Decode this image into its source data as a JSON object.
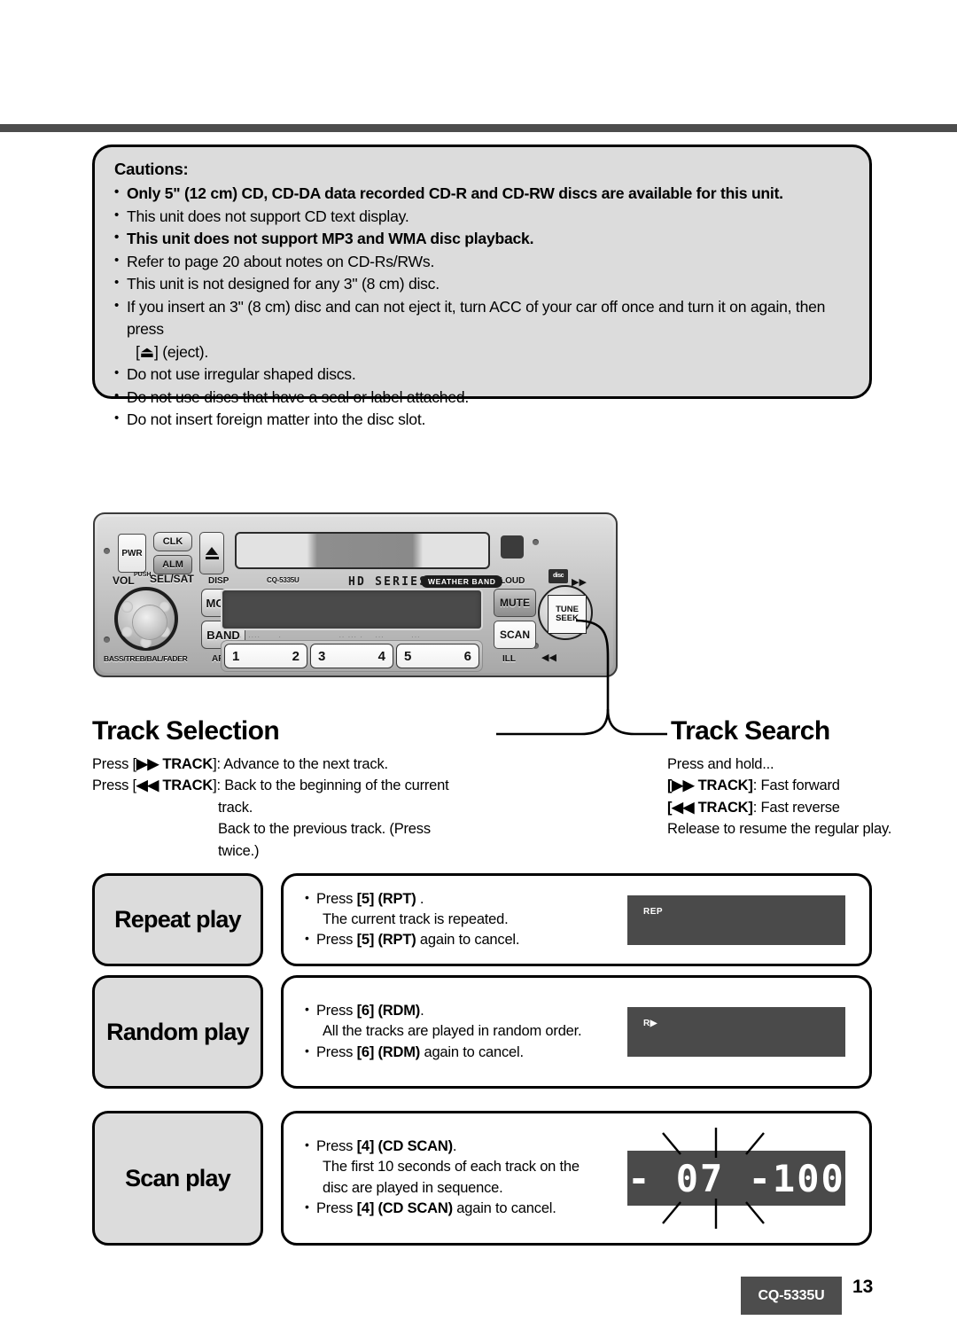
{
  "cautions": {
    "title": "Cautions:",
    "items": [
      {
        "text": "Only 5\" (12 cm) CD, CD-DA data recorded CD-R and CD-RW discs are available for this unit.",
        "bold": true
      },
      {
        "text": "This unit does not support CD text display.",
        "bold": false
      },
      {
        "text": "This unit does not support MP3 and WMA disc playback.",
        "bold": true
      },
      {
        "text": "Refer to page 20 about notes on CD-Rs/RWs.",
        "bold": false
      },
      {
        "text": "This unit is not designed for any 3\" (8 cm) disc.",
        "bold": false
      },
      {
        "text": "If you insert an 3\" (8 cm) disc and can not eject it, turn ACC of your car off once and turn it on again, then press",
        "bold": false
      },
      {
        "text": "[⏏] (eject).",
        "bold": false,
        "continuation": true
      },
      {
        "text": "Do not use irregular shaped discs.",
        "bold": false
      },
      {
        "text": "Do not use discs that have a seal or label attached.",
        "bold": false
      },
      {
        "text": "Do not insert foreign matter into the disc slot.",
        "bold": false
      }
    ]
  },
  "unit": {
    "model": "CQ-5335U",
    "pwr_label": "PWR",
    "clk_label": "CLK",
    "alm_label": "ALM",
    "eject_label": "eject",
    "vol_label": "VOL",
    "push_label": "PUSH",
    "selsat_label": "SEL/SAT",
    "disp_label": "DISP",
    "mode_label": "MODE",
    "band_label": "BAND",
    "apm_label": "APM",
    "bass_label": "BASS/TREB/BAL/FADER",
    "hd_series": "HD SERIES",
    "weather_band": "WEATHER BAND",
    "disc_logo": "disc",
    "loud_label": "LOUD",
    "mute_label": "MUTE",
    "scan_label": "SCAN",
    "ill_label": "ILL",
    "tune_label": "TUNE",
    "seek_label": "SEEK",
    "ff_arrow": "▶▶",
    "rw_arrow": "◀◀",
    "presets": [
      {
        "left": "1",
        "right": "2"
      },
      {
        "left": "3",
        "right": "4"
      },
      {
        "left": "5",
        "right": "6"
      }
    ]
  },
  "track_selection": {
    "heading": "Track Selection",
    "line1_prefix": "Press [",
    "line1_key": "▶▶ TRACK",
    "line1_suffix": "]: Advance to the next track.",
    "line2_prefix": "Press [",
    "line2_key": "◀◀ TRACK",
    "line2_suffix": "]: Back to the beginning of the current",
    "line3": "track.",
    "line4": "Back to the previous track. (Press",
    "line5": "twice.)"
  },
  "track_search": {
    "heading": "Track Search",
    "line1": "Press and hold...",
    "line2_key": "[▶▶ TRACK]",
    "line2_suffix": ": Fast forward",
    "line3_key": "[◀◀ TRACK]",
    "line3_suffix": ": Fast reverse",
    "line4": "Release to resume the regular play."
  },
  "features": [
    {
      "name": "Repeat play",
      "lines": [
        {
          "pre": "Press ",
          "key": "[5] (RPT)",
          "post": " .",
          "bullet": true
        },
        {
          "pre": "The current track is repeated.",
          "key": "",
          "post": "",
          "bullet": false
        },
        {
          "pre": "Press ",
          "key": "[5] (RPT)",
          "post": " again to cancel.",
          "bullet": true
        }
      ],
      "display": {
        "type": "indicator",
        "indicator": "REP"
      }
    },
    {
      "name": "Random play",
      "lines": [
        {
          "pre": "Press ",
          "key": "[6] (RDM)",
          "post": ".",
          "bullet": true
        },
        {
          "pre": "All the tracks are played in random order.",
          "key": "",
          "post": "",
          "bullet": false
        },
        {
          "pre": "Press ",
          "key": "[6] (RDM)",
          "post": " again to cancel.",
          "bullet": true
        }
      ],
      "display": {
        "type": "indicator",
        "indicator": "R▶"
      }
    },
    {
      "name": "Scan play",
      "lines": [
        {
          "pre": "Press ",
          "key": "[4] (CD SCAN)",
          "post": ".",
          "bullet": true
        },
        {
          "pre": "The first 10 seconds of each track on the",
          "key": "",
          "post": "",
          "bullet": false
        },
        {
          "pre": "disc are played in sequence.",
          "key": "",
          "post": "",
          "bullet": false
        },
        {
          "pre": "Press ",
          "key": "[4] (CD SCAN)",
          "post": " again to cancel.",
          "bullet": true
        }
      ],
      "display": {
        "type": "seven-segment",
        "segments": "- 07 -100",
        "track_number": "07",
        "time_value": "100",
        "flashing": true
      }
    }
  ],
  "footer": {
    "model_badge": "CQ-5335U",
    "page_number": "13"
  },
  "colors": {
    "panel_gray": "#dcdcdc",
    "display_dark": "#4a4a4a",
    "rule_gray": "#4d4d4d"
  }
}
